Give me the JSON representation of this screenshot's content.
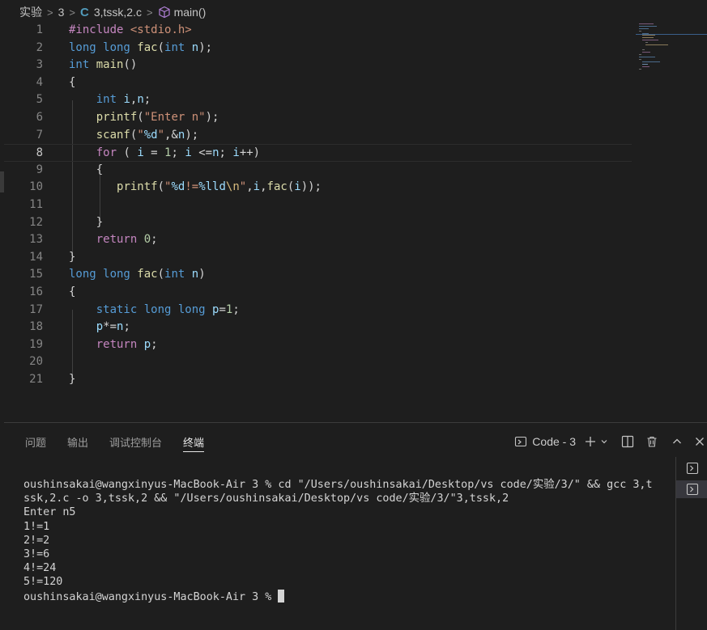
{
  "breadcrumb": {
    "folder": "实验",
    "subfolder": "3",
    "file_icon": "C",
    "file": "3,tssk,2.c",
    "symbol_icon": "cube-icon",
    "symbol": "main()"
  },
  "editor": {
    "current_line": 8,
    "line_numbers": [
      "1",
      "2",
      "3",
      "4",
      "5",
      "6",
      "7",
      "8",
      "9",
      "10",
      "11",
      "12",
      "13",
      "14",
      "15",
      "16",
      "17",
      "18",
      "19",
      "20",
      "21"
    ]
  },
  "panel": {
    "tabs": [
      "问题",
      "输出",
      "调试控制台",
      "终端"
    ],
    "active_tab": "终端",
    "terminal_name": "Code - 3",
    "icons": [
      "terminal-icon",
      "plus-icon",
      "chevron-down-icon",
      "split-icon",
      "trash-icon",
      "chevron-up-icon",
      "close-icon"
    ]
  },
  "terminal": {
    "lines": [
      "oushinsakai@wangxinyus-MacBook-Air 3 % cd \"/Users/oushinsakai/Desktop/vs code/实验/3/\" && gcc 3,t",
      "ssk,2.c -o 3,tssk,2 && \"/Users/oushinsakai/Desktop/vs code/实验/3/\"3,tssk,2",
      "Enter n5",
      "1!=1",
      "2!=2",
      "3!=6",
      "4!=24",
      "5!=120"
    ],
    "prompt": "oushinsakai@wangxinyus-MacBook-Air 3 % "
  },
  "colors": {
    "background": "#1e1e1e",
    "keyword": "#569cd6",
    "control": "#c586c0",
    "function": "#dcdcaa",
    "variable": "#9cdcfe",
    "string": "#ce9178",
    "number": "#b5cea8"
  }
}
